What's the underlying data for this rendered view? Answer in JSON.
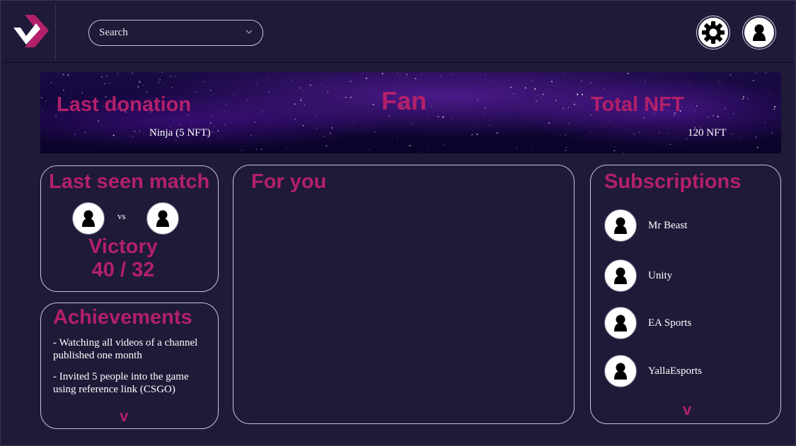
{
  "header": {
    "search": {
      "value": "Search"
    },
    "icons": {
      "logo": "brand-logo-icon",
      "settings": "gear-icon",
      "profile": "user-icon"
    }
  },
  "banner": {
    "last_donation_label": "Last donation",
    "last_donation_value": "Ninja (5 NFT)",
    "role": "Fan",
    "total_nft_label": "Total NFT",
    "total_nft_value": "120 NFT"
  },
  "last_match": {
    "title": "Last seen match",
    "vs": "vs",
    "result": "Victory",
    "score": "40 / 32"
  },
  "achievements": {
    "title": "Achievements",
    "items": [
      "- Watching all videos of a channel published one month",
      "- Invited 5 people into the game using reference link (CSGO)"
    ],
    "more": "v"
  },
  "for_you": {
    "title": "For you"
  },
  "subscriptions": {
    "title": "Subscriptions",
    "items": [
      {
        "name": "Mr Beast"
      },
      {
        "name": "Unity"
      },
      {
        "name": "EA Sports"
      },
      {
        "name": "YallaEsports"
      }
    ],
    "more": "v"
  },
  "colors": {
    "background": "#1e1a38",
    "accent": "#b3206a",
    "border": "#c9c6d8"
  }
}
